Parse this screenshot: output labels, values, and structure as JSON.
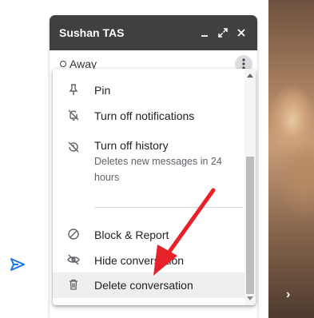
{
  "chat": {
    "title": "Sushan TAS",
    "status": "Away"
  },
  "menu": {
    "items": [
      {
        "label": "Pin",
        "icon": "pin-icon"
      },
      {
        "label": "Turn off notifications",
        "icon": "notifications-off-icon"
      },
      {
        "label": "Turn off history",
        "sublabel": "Deletes new messages in 24 hours",
        "icon": "history-off-icon"
      },
      {
        "label": "Block & Report",
        "icon": "block-icon"
      },
      {
        "label": "Hide conversation",
        "icon": "hide-icon"
      },
      {
        "label": "Delete conversation",
        "icon": "trash-icon"
      }
    ]
  },
  "colors": {
    "header_bg": "#404040",
    "annotation_arrow": "#e8202a",
    "send_icon": "#1a73e8"
  }
}
